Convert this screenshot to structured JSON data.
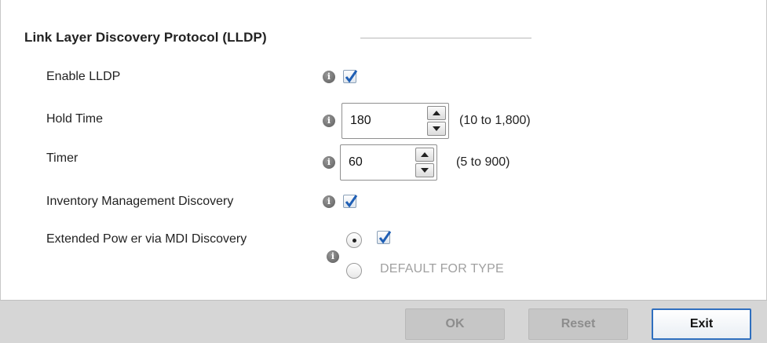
{
  "section": {
    "title": "Link Layer Discovery Protocol (LLDP)"
  },
  "fields": {
    "enable_lldp": {
      "label": "Enable LLDP",
      "checked": true
    },
    "hold_time": {
      "label": "Hold Time",
      "value": "180",
      "range": "(10 to 1,800)"
    },
    "timer": {
      "label": "Timer",
      "value": "60",
      "range": "(5 to 900)"
    },
    "inventory_mgmt": {
      "label": "Inventory Management Discovery",
      "checked": true
    },
    "extended_power": {
      "label": "Extended Pow er via MDI Discovery",
      "checked": true,
      "default_label": "DEFAULT FOR TYPE",
      "selected_option": "custom"
    }
  },
  "footer": {
    "ok_label": "OK",
    "reset_label": "Reset",
    "exit_label": "Exit"
  },
  "colors": {
    "checkmark": "#1f5fb5",
    "exit_border": "#2f6fbf",
    "footer_bg": "#d6d6d6"
  }
}
